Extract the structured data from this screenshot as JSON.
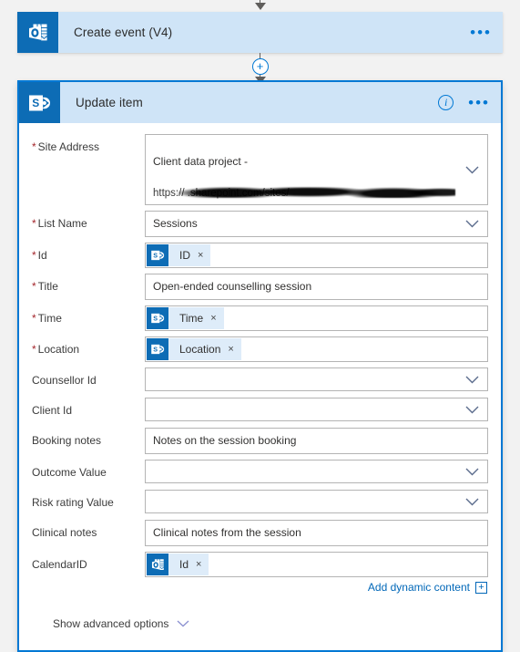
{
  "flow": {
    "top_arrow": "arrow-down-icon",
    "insert_step": {
      "icon": "plus-icon",
      "label": "+"
    }
  },
  "create_event_card": {
    "connector_icon": "outlook-calendar-icon",
    "title": "Create event (V4)",
    "overflow_label": "•••"
  },
  "update_item_card": {
    "connector_icon": "sharepoint-icon",
    "title": "Update item",
    "info_label": "i",
    "overflow_label": "•••",
    "fields": [
      {
        "label": "Site Address",
        "required": true,
        "type": "dropdown",
        "value_line1": "Client data project -",
        "value_line2": "https://              .sharepoint.com/sites/             ",
        "redacted": true
      },
      {
        "label": "List Name",
        "required": true,
        "type": "dropdown",
        "value": "Sessions"
      },
      {
        "label": "Id",
        "required": true,
        "type": "token",
        "token": {
          "icon": "sharepoint-icon",
          "text": "ID",
          "remove": "×"
        }
      },
      {
        "label": "Title",
        "required": true,
        "type": "text",
        "value": "Open-ended counselling session"
      },
      {
        "label": "Time",
        "required": true,
        "type": "token",
        "token": {
          "icon": "sharepoint-icon",
          "text": "Time",
          "remove": "×"
        }
      },
      {
        "label": "Location",
        "required": true,
        "type": "token",
        "token": {
          "icon": "sharepoint-icon",
          "text": "Location",
          "remove": "×"
        }
      },
      {
        "label": "Counsellor Id",
        "required": false,
        "type": "dropdown",
        "value": ""
      },
      {
        "label": "Client Id",
        "required": false,
        "type": "dropdown",
        "value": ""
      },
      {
        "label": "Booking notes",
        "required": false,
        "type": "text",
        "value": "Notes on the session booking"
      },
      {
        "label": "Outcome Value",
        "required": false,
        "type": "dropdown",
        "value": ""
      },
      {
        "label": "Risk rating Value",
        "required": false,
        "type": "dropdown",
        "value": ""
      },
      {
        "label": "Clinical notes",
        "required": false,
        "type": "text",
        "value": "Clinical notes from the session"
      },
      {
        "label": "CalendarID",
        "required": false,
        "type": "token",
        "token": {
          "icon": "outlook-calendar-icon",
          "text": "Id",
          "remove": "×"
        }
      }
    ],
    "add_dynamic_content": {
      "label": "Add dynamic content",
      "plus": "+"
    },
    "show_advanced_options": {
      "label": "Show advanced options",
      "icon": "chevron-down-icon"
    }
  },
  "colors": {
    "accent": "#0078d4",
    "connector_blue": "#0d6cb5",
    "header_blue": "#cfe4f7",
    "token_blue": "#deecf9",
    "required_red": "#a4262c",
    "link_blue": "#0067b8",
    "canvas": "#f2f2f2"
  }
}
